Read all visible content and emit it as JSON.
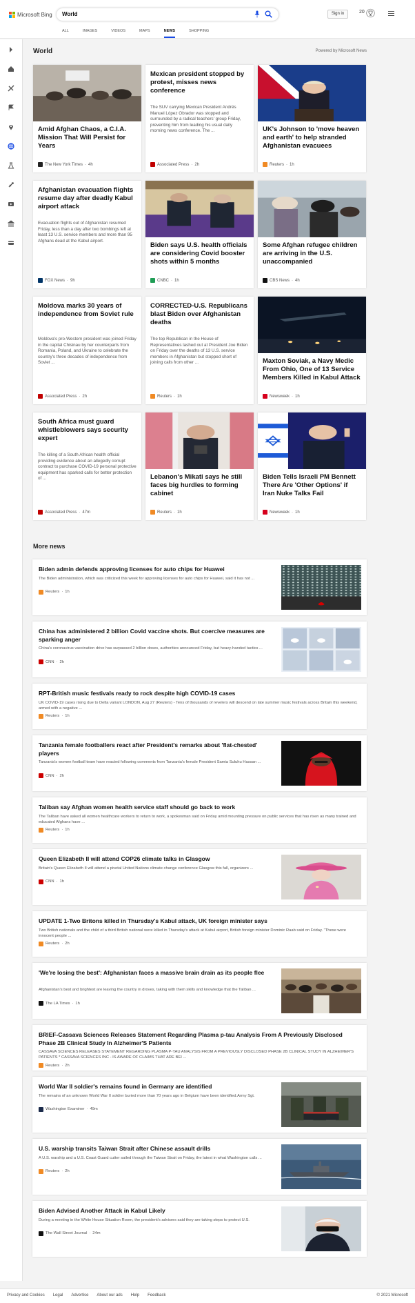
{
  "header": {
    "brand": "Microsoft Bing",
    "query": "World",
    "signin": "Sign in",
    "rewards_count": "20",
    "tabs": [
      {
        "label": "ALL"
      },
      {
        "label": "IMAGES"
      },
      {
        "label": "VIDEOS"
      },
      {
        "label": "MAPS"
      },
      {
        "label": "NEWS"
      },
      {
        "label": "SHOPPING"
      }
    ],
    "active_tab": "NEWS"
  },
  "section": {
    "title": "World",
    "powered": "Powered by Microsoft News"
  },
  "cards": [
    {
      "title": "Amid Afghan Chaos, a C.I.A. Mission That Will Persist for Years",
      "snippet": "",
      "source": "The New York Times",
      "age": "4h",
      "source_color": "#222222",
      "image": "crowd"
    },
    {
      "title": "Mexican president stopped by protest, misses news conference",
      "snippet": "The SUV carrying Mexican President Andrés Manuel López Obrador was stopped and surrounded by a radical teachers' group Friday, preventing him from leading his usual daily morning news conference. The ...",
      "source": "Associated Press",
      "age": "2h",
      "source_color": "#c00000",
      "image": ""
    },
    {
      "title": "UK's Johnson to 'move heaven and earth' to help stranded Afghanistan evacuees",
      "snippet": "",
      "source": "Reuters",
      "age": "1h",
      "source_color": "#f08a24",
      "image": "podium"
    },
    {
      "title": "Afghanistan evacuation flights resume day after deadly Kabul airport attack",
      "snippet": "Evacuation flights out of Afghanistan resumed Friday, less than a day after two bombings left at least 13 U.S. service members and more than 95 Afghans dead at the Kabul airport.",
      "source": "FOX News",
      "age": "9h",
      "source_color": "#003366",
      "image": ""
    },
    {
      "title": "Biden says U.S. health officials are considering Covid booster shots within 5 months",
      "snippet": "",
      "source": "CNBC",
      "age": "1h",
      "source_color": "#1f9d55",
      "image": "meeting"
    },
    {
      "title": "Some Afghan refugee children are arriving in the U.S. unaccompanied",
      "snippet": "",
      "source": "CBS News",
      "age": "4h",
      "source_color": "#111111",
      "image": "refugees"
    },
    {
      "title": "Moldova marks 30 years of independence from Soviet rule",
      "snippet": "Moldova's pro-Western president was joined Friday in the capital Chisinau by her counterparts from Romania, Poland, and Ukraine to celebrate the country's three decades of independence from Soviet ...",
      "source": "Associated Press",
      "age": "2h",
      "source_color": "#c00000",
      "image": ""
    },
    {
      "title": "CORRECTED-U.S. Republicans blast Biden over Afghanistan deaths",
      "snippet": "The top Republican in the House of Representatives lashed out at President Joe Biden on Friday over the deaths of 13 U.S. service members in Afghanistan but stopped short of joining calls from other ...",
      "source": "Reuters",
      "age": "1h",
      "source_color": "#f08a24",
      "image": ""
    },
    {
      "title": "Maxton Soviak, a Navy Medic From Ohio, One of 13 Service Members Killed in Kabul Attack",
      "snippet": "",
      "source": "Newsweek",
      "age": "1h",
      "source_color": "#d6001c",
      "image": "night"
    },
    {
      "title": "South Africa must guard whistleblowers says security expert",
      "snippet": "The killing of a South African health official providing evidence about an allegedly corrupt contract to purchase COVID-19 personal protective equipment has sparked calls for better protection of ...",
      "source": "Associated Press",
      "age": "47m",
      "source_color": "#c00000",
      "image": ""
    },
    {
      "title": "Lebanon's Mikati says he still faces big hurdles to forming cabinet",
      "snippet": "",
      "source": "Reuters",
      "age": "1h",
      "source_color": "#f08a24",
      "image": "mikati"
    },
    {
      "title": "Biden Tells Israeli PM Bennett There Are 'Other Options' if Iran Nuke Talks Fail",
      "snippet": "",
      "source": "Newsweek",
      "age": "1h",
      "source_color": "#d6001c",
      "image": "bennett"
    }
  ],
  "more_news": {
    "title": "More news",
    "items": [
      {
        "title": "Biden admin defends approving licenses for auto chips for Huawei",
        "snippet": "The Biden administration, which was criticized this week for approving licenses for auto chips for Huawei, said it has not ...",
        "source": "Reuters",
        "age": "1h",
        "source_color": "#f08a24",
        "image": "huawei"
      },
      {
        "title": "China has administered 2 billion Covid vaccine shots. But coercive measures are sparking anger",
        "snippet": "China's coronavirus vaccination drive has surpassed 2 billion doses, authorities announced Friday, but heavy-handed tactics ...",
        "source": "CNN",
        "age": "2h",
        "source_color": "#cc0000",
        "image": "vaccine"
      },
      {
        "title": "RPT-British music festivals ready to rock despite high COVID-19 cases",
        "snippet": "UK COVID-19 cases rising due to Delta variant LONDON, Aug 27 (Reuters) - Tens of thousands of revelers will descend on late summer music festivals across Britain this weekend, armed with a negative ...",
        "source": "Reuters",
        "age": "1h",
        "source_color": "#f08a24",
        "image": ""
      },
      {
        "title": "Tanzania female footballers react after President's remarks about 'flat-chested' players",
        "snippet": "Tanzania's women football team have reacted following comments from Tanzania's female President Samia Suluhu Hassan ...",
        "source": "CNN",
        "age": "2h",
        "source_color": "#cc0000",
        "image": "tanzania"
      },
      {
        "title": "Taliban say Afghan women health service staff should go back to work",
        "snippet": "The Taliban have asked all women healthcare workers to return to work, a spokesman said on Friday amid mounting pressure on public services that has risen as many trained and educated Afghans have ...",
        "source": "Reuters",
        "age": "1h",
        "source_color": "#f08a24",
        "image": ""
      },
      {
        "title": "Queen Elizabeth II will attend COP26 climate talks in Glasgow",
        "snippet": "Britain's Queen Elizabeth II will attend a pivotal United Nations climate change conference Glasgow this fall, organizers ...",
        "source": "CNN",
        "age": "1h",
        "source_color": "#cc0000",
        "image": "queen"
      },
      {
        "title": "UPDATE 1-Two Britons killed in Thursday's Kabul attack, UK foreign minister says",
        "snippet": "Two British nationals and the child of a third British national were killed in Thursday's attack at Kabul airport, British foreign minister Dominic Raab said on Friday. \"These were innocent people ...",
        "source": "Reuters",
        "age": "2h",
        "source_color": "#f08a24",
        "image": ""
      },
      {
        "title": "'We're losing the best': Afghanistan faces a massive brain drain as its people flee",
        "snippet": "Afghanistan's best and brightest are leaving the country in droves, taking with them skills and knowledge that the Taliban ...",
        "source": "The LA Times",
        "age": "1h",
        "source_color": "#111111",
        "image": "crowd2"
      },
      {
        "title": "BRIEF-Cassava Sciences Releases Statement Regarding Plasma p-tau Analysis From A Previously Disclosed Phase 2B Clinical Study In Alzheimer'S Patients",
        "snippet": "CASSAVA SCIENCES RELEASES STATEMENT REGARDING PLASMA P-TAU ANALYSIS FROM A PREVIOUSLY DISCLOSED PHASE 2B CLINICAL STUDY IN ALZHEIMER'S PATIENTS * CASSAVA SCIENCES INC - IS AWARE OF CLAIMS THAT ARE BEI ...",
        "source": "Reuters",
        "age": "2h",
        "source_color": "#f08a24",
        "image": ""
      },
      {
        "title": "World War II soldier's remains found in Germany are identified",
        "snippet": "The remains of an unknown World War II soldier buried more than 70 years ago in Belgium have been identified.Army Sgt.",
        "source": "Washington Examiner",
        "age": "49m",
        "source_color": "#1b2a4a",
        "image": "soldiers"
      },
      {
        "title": "U.S. warship transits Taiwan Strait after Chinese assault drills",
        "snippet": "A U.S. warship and a U.S. Coast Guard cutter sailed through the Taiwan Strait on Friday, the latest in what Washington calls ...",
        "source": "Reuters",
        "age": "2h",
        "source_color": "#f08a24",
        "image": "ship"
      },
      {
        "title": "Biden Advised Another Attack in Kabul Likely",
        "snippet": "During a meeting in the White House Situation Room, the president's advisers said they are taking steps to protect U.S.",
        "source": "The Wall Street Journal",
        "age": "24m",
        "source_color": "#111111",
        "image": "biden"
      }
    ]
  },
  "footer": {
    "links": [
      "Privacy and Cookies",
      "Legal",
      "Advertise",
      "About our ads",
      "Help",
      "Feedback"
    ],
    "copyright": "© 2021 Microsoft"
  }
}
